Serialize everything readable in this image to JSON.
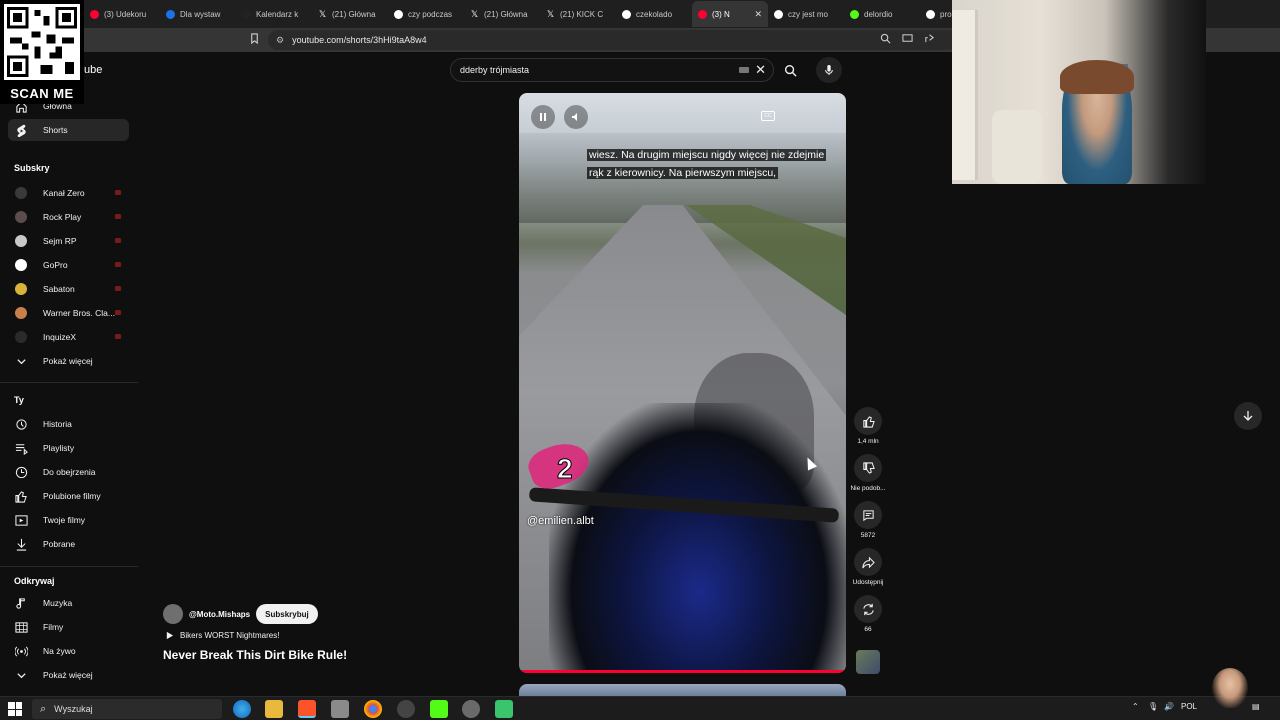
{
  "browser": {
    "tabs": [
      {
        "label": "(3) Udekoru",
        "fav_color": "#ff0033",
        "active": false
      },
      {
        "label": "Dla wystaw",
        "fav_color": "#1a73e8",
        "active": false
      },
      {
        "label": "Kalendarz k",
        "fav_color": "#222222",
        "active": false
      },
      {
        "label": "(21) Główna",
        "fav_color": "x",
        "active": false
      },
      {
        "label": "czy podczas",
        "fav_color": "#ffffff",
        "active": false
      },
      {
        "label": "(21) Główna",
        "fav_color": "x",
        "active": false
      },
      {
        "label": "(21) KICK C",
        "fav_color": "x",
        "active": false
      },
      {
        "label": "czekolado",
        "fav_color": "#ffffff",
        "active": false
      },
      {
        "label": "(3) N",
        "fav_color": "#ff0033",
        "active": true
      },
      {
        "label": "czy jest mo",
        "fav_color": "#ffffff",
        "active": false
      },
      {
        "label": "delordio",
        "fav_color": "#53fc18",
        "active": false
      },
      {
        "label": "pro",
        "fav_color": "#ffffff",
        "active": false
      }
    ],
    "url": "youtube.com/shorts/3hHi9taA8w4"
  },
  "qr": {
    "label": "SCAN ME"
  },
  "logo": {
    "text": "ube"
  },
  "sidebar": {
    "top_items": [
      {
        "label": "Główna",
        "icon": "home-icon"
      },
      {
        "label": "Shorts",
        "icon": "shorts-icon",
        "active": true
      }
    ],
    "subs_title": "Subskry",
    "subscriptions": [
      {
        "label": "Kanał Zero",
        "color": "#3a3a3a"
      },
      {
        "label": "Rock Play",
        "color": "#5a4d4d"
      },
      {
        "label": "Sejm RP",
        "color": "#c9c9c9"
      },
      {
        "label": "GoPro",
        "color": "#ffffff"
      },
      {
        "label": "Sabaton",
        "color": "#d8b23a"
      },
      {
        "label": "Warner Bros. Cla...",
        "color": "#c87f4a"
      },
      {
        "label": "InquizeX",
        "color": "#2b2b2b"
      }
    ],
    "show_more_1": "Pokaż więcej",
    "you_title": "Ty",
    "you_items": [
      {
        "label": "Historia",
        "icon": "history-icon"
      },
      {
        "label": "Playlisty",
        "icon": "playlist-icon"
      },
      {
        "label": "Do obejrzenia",
        "icon": "watch-later-icon"
      },
      {
        "label": "Polubione filmy",
        "icon": "like-icon"
      },
      {
        "label": "Twoje filmy",
        "icon": "your-videos-icon"
      },
      {
        "label": "Pobrane",
        "icon": "download-icon"
      }
    ],
    "explore_title": "Odkrywaj",
    "explore_items": [
      {
        "label": "Muzyka",
        "icon": "music-icon"
      },
      {
        "label": "Filmy",
        "icon": "film-icon"
      },
      {
        "label": "Na żywo",
        "icon": "live-icon"
      }
    ],
    "show_more_2": "Pokaż więcej"
  },
  "search": {
    "query": "dderby trójmiasta"
  },
  "player": {
    "caption_line1": "wiesz. Na drugim miejscu nigdy więcej nie zdejmie",
    "caption_line2": "rąk z kierownicy. Na pierwszym miejscu,",
    "overlay_number": "2",
    "creator_tag": "@emilien.albt",
    "progress": 1.0
  },
  "actions": {
    "likes": "1,4 mln",
    "dislike_label": "Nie podob...",
    "comments": "5872",
    "share_label": "Udostępnij",
    "remix_count": "66"
  },
  "channel": {
    "handle": "@Moto.Mishaps",
    "subscribe_label": "Subskrybuj",
    "sound_title": "Bikers WORST Nightmares!",
    "video_title": "Never Break This Dirt Bike Rule!"
  },
  "taskbar": {
    "search_placeholder": "Wyszukaj",
    "lang": "POL"
  }
}
